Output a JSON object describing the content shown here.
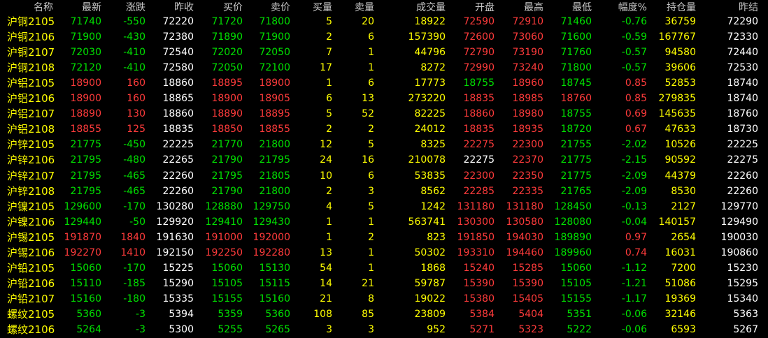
{
  "colors": {
    "up": "#ff3b3b",
    "down": "#00e000",
    "neutral": "#ffffff",
    "name": "#ffff00",
    "header": "#c8c8c8",
    "background": "#000000"
  },
  "headers": [
    "名称",
    "最新",
    "涨跌",
    "昨收",
    "买价",
    "卖价",
    "买量",
    "卖量",
    "成交量",
    "开盘",
    "最高",
    "最低",
    "幅度%",
    "持仓量",
    "昨结"
  ],
  "rows": [
    [
      "沪铜2105",
      "71740",
      "-550",
      "72220",
      "71720",
      "71800",
      "5",
      "20",
      "18922",
      "72590",
      "72910",
      "71460",
      "-0.76",
      "36759",
      "72290"
    ],
    [
      "沪铜2106",
      "71900",
      "-430",
      "72380",
      "71890",
      "71900",
      "2",
      "6",
      "157390",
      "72600",
      "73060",
      "71600",
      "-0.59",
      "167767",
      "72330"
    ],
    [
      "沪铜2107",
      "72030",
      "-410",
      "72540",
      "72020",
      "72050",
      "7",
      "1",
      "44796",
      "72790",
      "73190",
      "71760",
      "-0.57",
      "94580",
      "72440"
    ],
    [
      "沪铜2108",
      "72120",
      "-410",
      "72580",
      "72050",
      "72100",
      "17",
      "1",
      "8272",
      "72990",
      "73240",
      "71800",
      "-0.57",
      "39606",
      "72530"
    ],
    [
      "沪铝2105",
      "18900",
      "160",
      "18860",
      "18895",
      "18900",
      "1",
      "6",
      "17773",
      "18755",
      "18960",
      "18745",
      "0.85",
      "52853",
      "18740"
    ],
    [
      "沪铝2106",
      "18900",
      "160",
      "18865",
      "18900",
      "18905",
      "6",
      "13",
      "273220",
      "18835",
      "18985",
      "18760",
      "0.85",
      "279835",
      "18740"
    ],
    [
      "沪铝2107",
      "18890",
      "130",
      "18860",
      "18890",
      "18895",
      "5",
      "52",
      "82225",
      "18860",
      "18980",
      "18755",
      "0.69",
      "145635",
      "18760"
    ],
    [
      "沪铝2108",
      "18855",
      "125",
      "18835",
      "18850",
      "18855",
      "2",
      "2",
      "24012",
      "18835",
      "18935",
      "18720",
      "0.67",
      "47633",
      "18730"
    ],
    [
      "沪锌2105",
      "21775",
      "-450",
      "22225",
      "21770",
      "21800",
      "12",
      "5",
      "8325",
      "22275",
      "22300",
      "21755",
      "-2.02",
      "10526",
      "22225"
    ],
    [
      "沪锌2106",
      "21795",
      "-480",
      "22265",
      "21790",
      "21795",
      "24",
      "16",
      "210078",
      "22275",
      "22370",
      "21775",
      "-2.15",
      "90592",
      "22275"
    ],
    [
      "沪锌2107",
      "21795",
      "-465",
      "22260",
      "21795",
      "21805",
      "10",
      "6",
      "53835",
      "22300",
      "22350",
      "21775",
      "-2.09",
      "44379",
      "22260"
    ],
    [
      "沪锌2108",
      "21795",
      "-465",
      "22260",
      "21790",
      "21800",
      "2",
      "3",
      "8562",
      "22285",
      "22335",
      "21765",
      "-2.09",
      "8530",
      "22260"
    ],
    [
      "沪镍2105",
      "129600",
      "-170",
      "130280",
      "128880",
      "129750",
      "4",
      "5",
      "1242",
      "131180",
      "131180",
      "128450",
      "-0.13",
      "2127",
      "129770"
    ],
    [
      "沪镍2106",
      "129440",
      "-50",
      "129920",
      "129410",
      "129430",
      "1",
      "1",
      "563741",
      "130300",
      "130580",
      "128080",
      "-0.04",
      "140157",
      "129490"
    ],
    [
      "沪锡2105",
      "191870",
      "1840",
      "191630",
      "191000",
      "192000",
      "1",
      "2",
      "823",
      "191850",
      "194030",
      "189890",
      "0.97",
      "2654",
      "190030"
    ],
    [
      "沪锡2106",
      "192270",
      "1410",
      "192150",
      "192250",
      "192280",
      "13",
      "1",
      "50302",
      "193310",
      "194460",
      "189960",
      "0.74",
      "16031",
      "190860"
    ],
    [
      "沪铅2105",
      "15060",
      "-170",
      "15225",
      "15060",
      "15130",
      "54",
      "1",
      "1868",
      "15240",
      "15285",
      "15060",
      "-1.12",
      "7200",
      "15230"
    ],
    [
      "沪铅2106",
      "15110",
      "-185",
      "15290",
      "15105",
      "15115",
      "14",
      "21",
      "59787",
      "15390",
      "15390",
      "15105",
      "-1.21",
      "51086",
      "15295"
    ],
    [
      "沪铅2107",
      "15160",
      "-180",
      "15335",
      "15155",
      "15160",
      "21",
      "8",
      "19022",
      "15380",
      "15405",
      "15155",
      "-1.17",
      "19369",
      "15340"
    ],
    [
      "螺纹2105",
      "5360",
      "-3",
      "5394",
      "5359",
      "5360",
      "108",
      "85",
      "23809",
      "5384",
      "5404",
      "5351",
      "-0.06",
      "32146",
      "5363"
    ],
    [
      "螺纹2106",
      "5264",
      "-3",
      "5300",
      "5255",
      "5265",
      "3",
      "3",
      "952",
      "5271",
      "5323",
      "5222",
      "-0.06",
      "6593",
      "5267"
    ]
  ],
  "colorClasses": [
    [
      "y",
      "g",
      "g",
      "w",
      "g",
      "g",
      "y",
      "y",
      "y",
      "r",
      "r",
      "g",
      "g",
      "y",
      "w"
    ],
    [
      "y",
      "g",
      "g",
      "w",
      "g",
      "g",
      "y",
      "y",
      "y",
      "r",
      "r",
      "g",
      "g",
      "y",
      "w"
    ],
    [
      "y",
      "g",
      "g",
      "w",
      "g",
      "g",
      "y",
      "y",
      "y",
      "r",
      "r",
      "g",
      "g",
      "y",
      "w"
    ],
    [
      "y",
      "g",
      "g",
      "w",
      "g",
      "g",
      "y",
      "y",
      "y",
      "r",
      "r",
      "g",
      "g",
      "y",
      "w"
    ],
    [
      "y",
      "r",
      "r",
      "w",
      "r",
      "r",
      "y",
      "y",
      "y",
      "g",
      "r",
      "g",
      "r",
      "y",
      "w"
    ],
    [
      "y",
      "r",
      "r",
      "w",
      "r",
      "r",
      "y",
      "y",
      "y",
      "r",
      "r",
      "r",
      "r",
      "y",
      "w"
    ],
    [
      "y",
      "r",
      "r",
      "w",
      "r",
      "r",
      "y",
      "y",
      "y",
      "r",
      "r",
      "g",
      "r",
      "y",
      "w"
    ],
    [
      "y",
      "r",
      "r",
      "w",
      "r",
      "r",
      "y",
      "y",
      "y",
      "r",
      "r",
      "g",
      "r",
      "y",
      "w"
    ],
    [
      "y",
      "g",
      "g",
      "w",
      "g",
      "g",
      "y",
      "y",
      "y",
      "r",
      "r",
      "g",
      "g",
      "y",
      "w"
    ],
    [
      "y",
      "g",
      "g",
      "w",
      "g",
      "g",
      "y",
      "y",
      "y",
      "w",
      "r",
      "g",
      "g",
      "y",
      "w"
    ],
    [
      "y",
      "g",
      "g",
      "w",
      "g",
      "g",
      "y",
      "y",
      "y",
      "r",
      "r",
      "g",
      "g",
      "y",
      "w"
    ],
    [
      "y",
      "g",
      "g",
      "w",
      "g",
      "g",
      "y",
      "y",
      "y",
      "r",
      "r",
      "g",
      "g",
      "y",
      "w"
    ],
    [
      "y",
      "g",
      "g",
      "w",
      "g",
      "g",
      "y",
      "y",
      "y",
      "r",
      "r",
      "g",
      "g",
      "y",
      "w"
    ],
    [
      "y",
      "g",
      "g",
      "w",
      "g",
      "g",
      "y",
      "y",
      "y",
      "r",
      "r",
      "g",
      "g",
      "y",
      "w"
    ],
    [
      "y",
      "r",
      "r",
      "w",
      "r",
      "r",
      "y",
      "y",
      "y",
      "r",
      "r",
      "g",
      "r",
      "y",
      "w"
    ],
    [
      "y",
      "r",
      "r",
      "w",
      "r",
      "r",
      "y",
      "y",
      "y",
      "r",
      "r",
      "g",
      "r",
      "y",
      "w"
    ],
    [
      "y",
      "g",
      "g",
      "w",
      "g",
      "g",
      "y",
      "y",
      "y",
      "r",
      "r",
      "g",
      "g",
      "y",
      "w"
    ],
    [
      "y",
      "g",
      "g",
      "w",
      "g",
      "g",
      "y",
      "y",
      "y",
      "r",
      "r",
      "g",
      "g",
      "y",
      "w"
    ],
    [
      "y",
      "g",
      "g",
      "w",
      "g",
      "g",
      "y",
      "y",
      "y",
      "r",
      "r",
      "g",
      "g",
      "y",
      "w"
    ],
    [
      "y",
      "g",
      "g",
      "w",
      "g",
      "g",
      "y",
      "y",
      "y",
      "r",
      "r",
      "g",
      "g",
      "y",
      "w"
    ],
    [
      "y",
      "g",
      "g",
      "w",
      "g",
      "g",
      "y",
      "y",
      "y",
      "r",
      "r",
      "g",
      "g",
      "y",
      "w"
    ]
  ]
}
